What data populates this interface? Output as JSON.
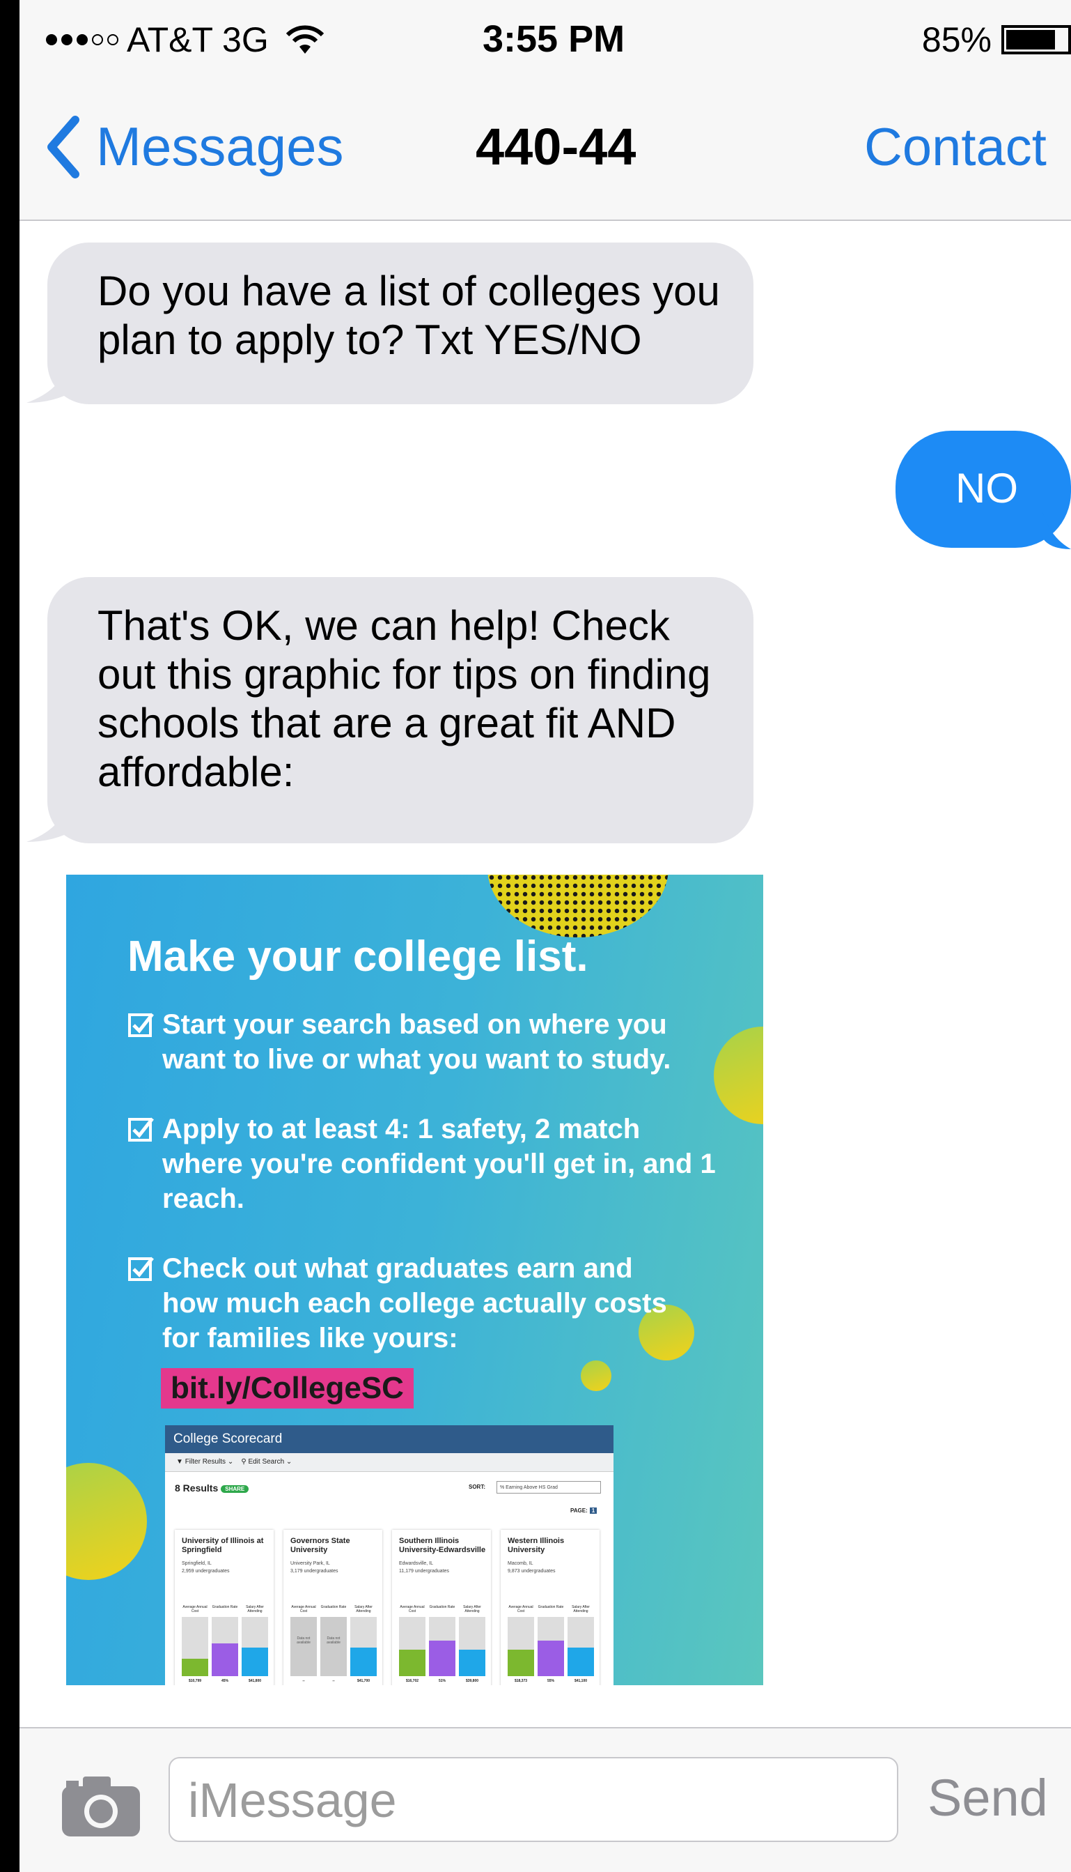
{
  "status_bar": {
    "carrier": "AT&T 3G",
    "time": "3:55 PM",
    "battery": "85%",
    "battery_level": 0.85
  },
  "nav": {
    "back_label": "Messages",
    "title": "440-44",
    "contact_label": "Contact"
  },
  "messages": [
    {
      "from": "them",
      "text": "Do you have a list of colleges you plan to apply to? Txt YES/NO"
    },
    {
      "from": "me",
      "text": "NO"
    },
    {
      "from": "them",
      "text": "That's OK, we can help! Check out this graphic for tips on finding schools that are a great fit AND affordable:"
    }
  ],
  "graphic": {
    "title": "Make your college list.",
    "items": [
      "Start your search based on where you want to live or what you want to study.",
      "Apply to at least 4: 1 safety, 2 match where you're confident you'll get in, and 1 reach.",
      "Check out what graduates earn and how much each college actually costs for families like yours:"
    ],
    "link": "bit.ly/CollegeSC",
    "scorecard": {
      "header": "College Scorecard",
      "filter": "Filter Results",
      "edit": "Edit Search",
      "results": "8 Results",
      "share": "SHARE",
      "sort_label": "SORT:",
      "sort_value": "% Earning Above HS Grad",
      "page_label": "PAGE:",
      "page_num": "1",
      "col_cost": "Average Annual Cost",
      "col_grad": "Graduation Rate",
      "col_salary": "Salary After Attending",
      "na": "Data not available",
      "cards": [
        {
          "name": "University of Illinois at Springfield",
          "location": "Springfield, IL",
          "size": "2,959 undergraduates",
          "cost": "$10,799",
          "grad": "45%",
          "salary": "$41,800",
          "cost_fill": 0.3,
          "grad_fill": 0.55,
          "salary_fill": 0.48
        },
        {
          "name": "Governors State University",
          "location": "University Park, IL",
          "size": "3,179 undergraduates",
          "cost": "--",
          "grad": "--",
          "salary": "$41,700",
          "cost_fill": null,
          "grad_fill": null,
          "salary_fill": 0.48
        },
        {
          "name": "Southern Illinois University-Edwardsville",
          "location": "Edwardsville, IL",
          "size": "11,179 undergraduates",
          "cost": "$16,702",
          "grad": "51%",
          "salary": "$39,800",
          "cost_fill": 0.45,
          "grad_fill": 0.6,
          "salary_fill": 0.45
        },
        {
          "name": "Western Illinois University",
          "location": "Macomb, IL",
          "size": "9,873 undergraduates",
          "cost": "$18,373",
          "grad": "55%",
          "salary": "$41,100",
          "cost_fill": 0.45,
          "grad_fill": 0.6,
          "salary_fill": 0.48
        }
      ]
    }
  },
  "input": {
    "placeholder": "iMessage",
    "send_label": "Send"
  },
  "colors": {
    "ios_blue": "#1f7ae0",
    "outgoing_bubble": "#1d8bf5",
    "incoming_bubble": "#e5e5ea",
    "link_highlight": "#e4388d",
    "bar_green": "#7cb82f",
    "bar_purple": "#9b5de5",
    "bar_blue": "#1fa7e8"
  },
  "icons": [
    "signal-dots-icon",
    "wifi-icon",
    "battery-icon",
    "chevron-left-icon",
    "camera-icon",
    "checkbox-icon"
  ]
}
